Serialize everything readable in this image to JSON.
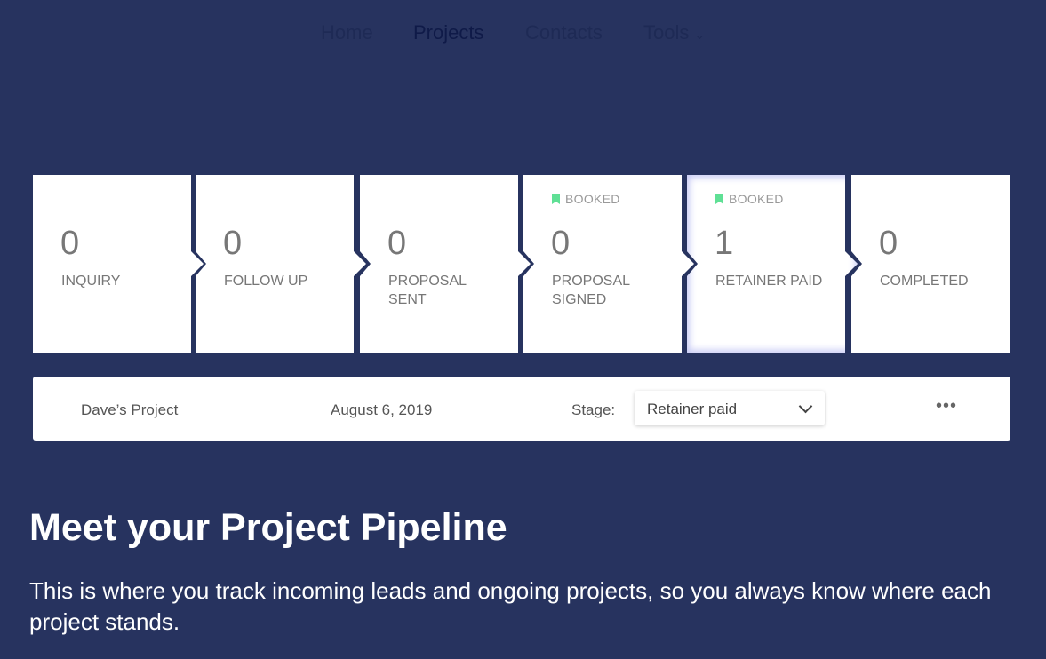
{
  "nav": {
    "items": [
      {
        "label": "Home"
      },
      {
        "label": "Projects",
        "active": true
      },
      {
        "label": "Contacts"
      },
      {
        "label": "Tools"
      }
    ]
  },
  "pipeline": {
    "stages": [
      {
        "count": "0",
        "label": "Inquiry",
        "booked": ""
      },
      {
        "count": "0",
        "label": "Follow up",
        "booked": ""
      },
      {
        "count": "0",
        "label": "Proposal sent",
        "booked": ""
      },
      {
        "count": "0",
        "label": "Proposal signed",
        "booked": "BOOKED"
      },
      {
        "count": "1",
        "label": "Retainer paid",
        "booked": "BOOKED",
        "selected": true
      },
      {
        "count": "0",
        "label": "Completed",
        "booked": ""
      }
    ]
  },
  "project": {
    "name": "Dave’s Project",
    "date": "August 6, 2019",
    "stage_label": "Stage:",
    "stage_value": "Retainer paid",
    "more": "•••"
  },
  "hero": {
    "title": "Meet your Project Pipeline",
    "description": "This is where you track incoming leads and ongoing projects, so you always know where each project stands."
  },
  "colors": {
    "background": "#27335f",
    "booked_icon": "#5fe095"
  }
}
